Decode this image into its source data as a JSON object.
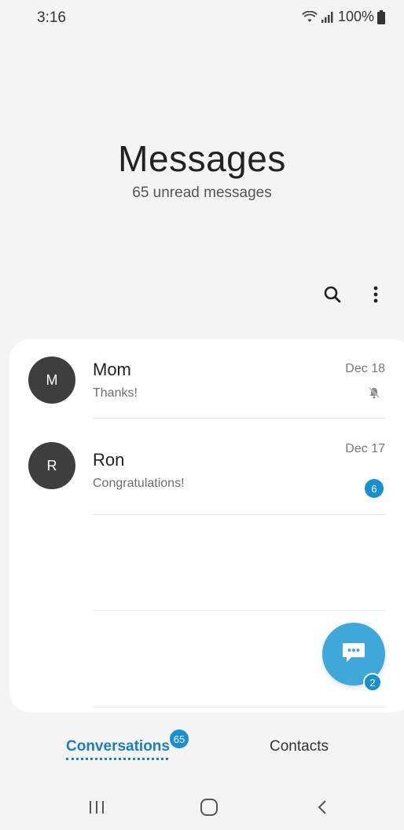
{
  "status_bar": {
    "time": "3:16",
    "battery": "100%",
    "icons": [
      "wifi-icon",
      "signal-icon",
      "battery-icon"
    ]
  },
  "header": {
    "title": "Messages",
    "subtitle": "65 unread messages"
  },
  "toolbar": {
    "icons": [
      "search-icon",
      "more-vertical-icon"
    ]
  },
  "conversations": [
    {
      "initial": "M",
      "name": "Mom",
      "preview": "Thanks!",
      "date": "Dec 18",
      "muted": true
    },
    {
      "initial": "R",
      "name": "Ron",
      "preview": "Congratulations!",
      "date": "Dec 17",
      "unread_count": "6"
    }
  ],
  "fab": {
    "icon": "compose-message-icon",
    "badge": "2"
  },
  "tabs": [
    {
      "label": "Conversations",
      "active": true,
      "badge": "65"
    },
    {
      "label": "Contacts",
      "active": false
    }
  ],
  "nav": {
    "icons": [
      "recent-apps-icon",
      "home-icon",
      "back-icon"
    ]
  },
  "colors": {
    "accent": "#1a7fbf",
    "badge": "#1a8fd0",
    "fab": "#3ea9d8",
    "avatar": "#3e3e3e",
    "background": "#f4f4f4"
  }
}
